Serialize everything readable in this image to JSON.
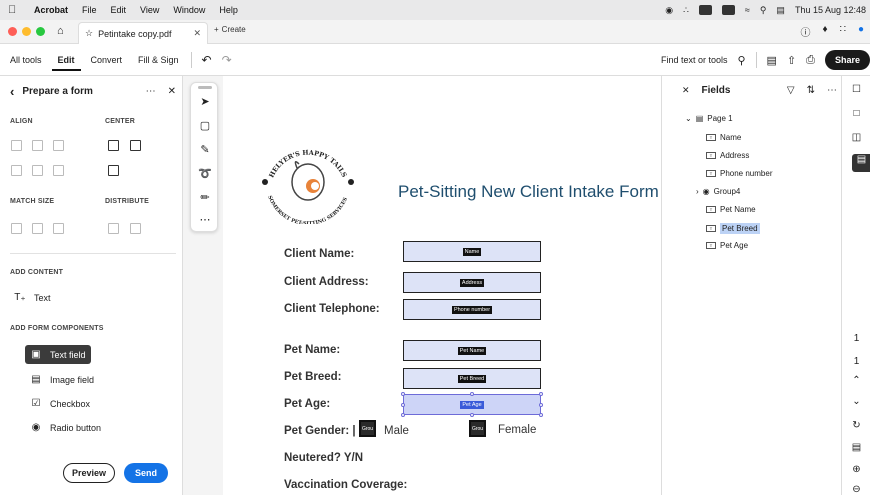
{
  "menubar": {
    "app": "Acrobat",
    "items": [
      "File",
      "Edit",
      "View",
      "Window",
      "Help"
    ],
    "clock": "Thu 15 Aug  12:48"
  },
  "tabbar": {
    "tab_title": "Petintake copy.pdf",
    "new_tab_label": "Create"
  },
  "toolbar": {
    "tabs": [
      "All tools",
      "Edit",
      "Convert",
      "Fill & Sign"
    ],
    "active_tab": "Edit",
    "search_label": "Find text or tools",
    "share_label": "Share"
  },
  "left_panel": {
    "title": "Prepare a form",
    "align_label": "ALIGN",
    "center_label": "CENTER",
    "match_size_label": "MATCH SIZE",
    "distribute_label": "DISTRIBUTE",
    "add_content_label": "ADD CONTENT",
    "text_label": "Text",
    "add_form_label": "ADD FORM COMPONENTS",
    "components": [
      "Text field",
      "Image field",
      "Checkbox",
      "Radio button"
    ],
    "preview_label": "Preview",
    "send_label": "Send"
  },
  "document": {
    "logo_text_top": "HELYER'S HAPPY TAILS",
    "logo_text_bottom": "SOMERSET PET-SITTING SERVICES",
    "title": "Pet-Sitting New Client Intake Form",
    "fields": [
      {
        "label": "Client Name:",
        "tag": "Name"
      },
      {
        "label": "Client Address:",
        "tag": "Address"
      },
      {
        "label": "Client Telephone:",
        "tag": "Phone number"
      },
      {
        "label": "Pet Name:",
        "tag": "Pet Name"
      },
      {
        "label": "Pet Breed:",
        "tag": "Pet Breed"
      },
      {
        "label": "Pet Age:",
        "tag": "Pet Age"
      }
    ],
    "gender_label": "Pet Gender: |",
    "gender_male": "Male",
    "gender_female": "Female",
    "checkbox_tag": "Grou",
    "neutered_label": "Neutered? Y/N",
    "vaccination_label": "Vaccination Coverage:"
  },
  "fields_panel": {
    "title": "Fields",
    "page_label": "Page 1",
    "items": [
      "Name",
      "Address",
      "Phone number",
      "Group4",
      "Pet Name",
      "Pet Breed",
      "Pet Age"
    ],
    "selected": "Pet Breed"
  },
  "page_indicator": [
    "1",
    "1"
  ]
}
